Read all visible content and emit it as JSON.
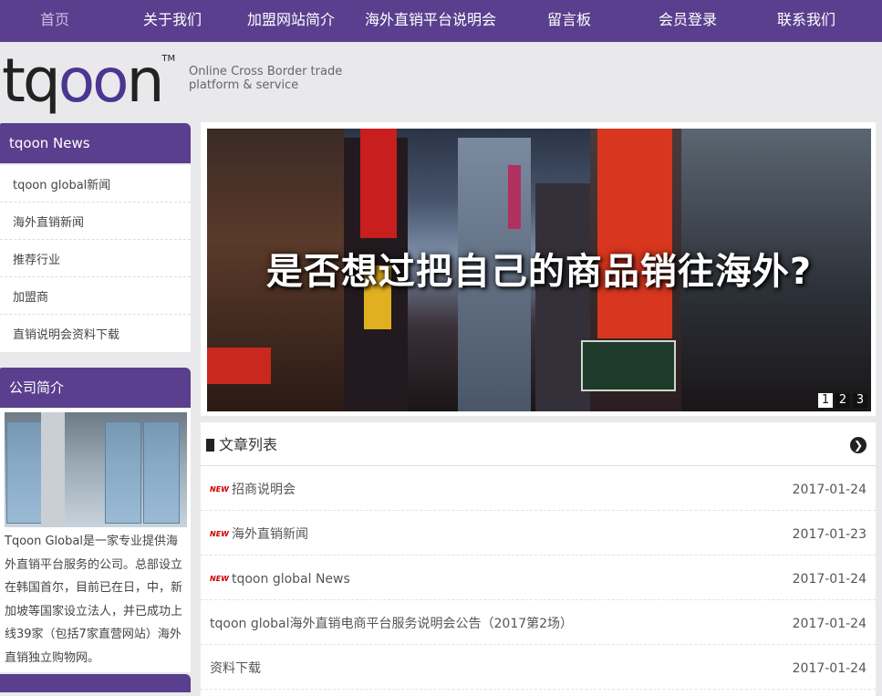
{
  "nav": {
    "items": [
      "首页",
      "关于我们",
      "加盟网站简介",
      "海外直销平台说明会",
      "留言板",
      "会员登录",
      "联系我们"
    ]
  },
  "header": {
    "logo_text": "tqoon",
    "logo_tm": "TM",
    "tagline": "Online Cross Border trade platform & service"
  },
  "sidebar": {
    "news_title": "tqoon News",
    "news_items": [
      "tqoon global新闻",
      "海外直销新闻",
      "推荐行业",
      "加盟商",
      "直销说明会资料下载"
    ],
    "company_title": "公司简介",
    "company_text": "Tqoon Global是一家专业提供海外直销平台服务的公司。总部设立在韩国首尔，目前已在日，中，新加坡等国家设立法人，并已成功上线39家（包括7家直营网站）海外直销独立购物网。"
  },
  "banner": {
    "headline": "是否想过把自己的商品销往海外?",
    "dots": [
      "1",
      "2",
      "3"
    ],
    "active_dot": 0
  },
  "articles": {
    "title": "文章列表",
    "new_badge": "NEW",
    "rows": [
      {
        "title": "招商说明会",
        "date": "2017-01-24",
        "is_new": true
      },
      {
        "title": "海外直销新闻",
        "date": "2017-01-23",
        "is_new": true
      },
      {
        "title": "tqoon global News",
        "date": "2017-01-24",
        "is_new": true
      },
      {
        "title": "tqoon global海外直销电商平台服务说明会公告（2017第2场）",
        "date": "2017-01-24",
        "is_new": false
      },
      {
        "title": "资料下载",
        "date": "2017-01-24",
        "is_new": false
      }
    ]
  },
  "colors": {
    "brand_purple": "#5a3f8e",
    "page_bg": "#e9e9ec"
  }
}
